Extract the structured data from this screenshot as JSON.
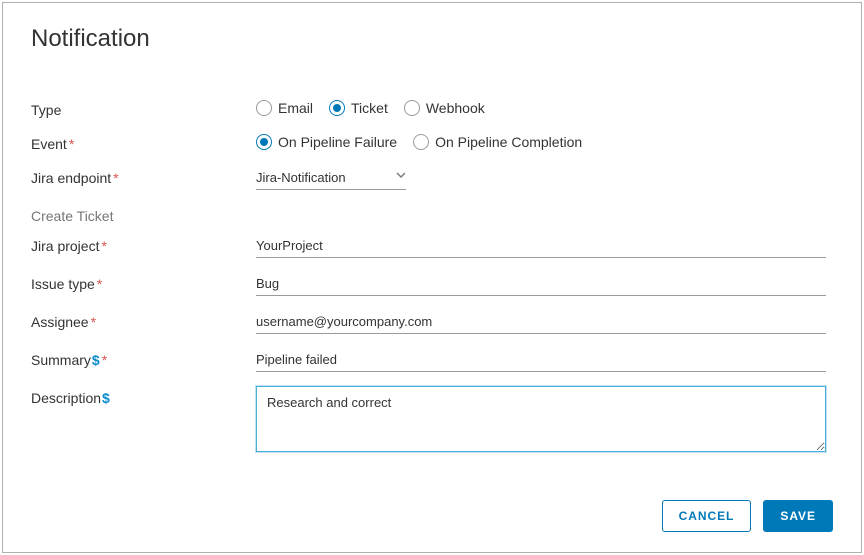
{
  "title": "Notification",
  "labels": {
    "type": "Type",
    "event": "Event",
    "jira_endpoint": "Jira endpoint",
    "create_ticket": "Create Ticket",
    "jira_project": "Jira project",
    "issue_type": "Issue type",
    "assignee": "Assignee",
    "summary": "Summary",
    "description": "Description"
  },
  "type_options": {
    "email": "Email",
    "ticket": "Ticket",
    "webhook": "Webhook"
  },
  "event_options": {
    "failure": "On Pipeline Failure",
    "completion": "On Pipeline Completion"
  },
  "values": {
    "type_selected": "ticket",
    "event_selected": "failure",
    "jira_endpoint": "Jira-Notification",
    "jira_project": "YourProject",
    "issue_type": "Bug",
    "assignee": "username@yourcompany.com",
    "summary": "Pipeline failed",
    "description": "Research and correct"
  },
  "buttons": {
    "cancel": "CANCEL",
    "save": "SAVE"
  }
}
